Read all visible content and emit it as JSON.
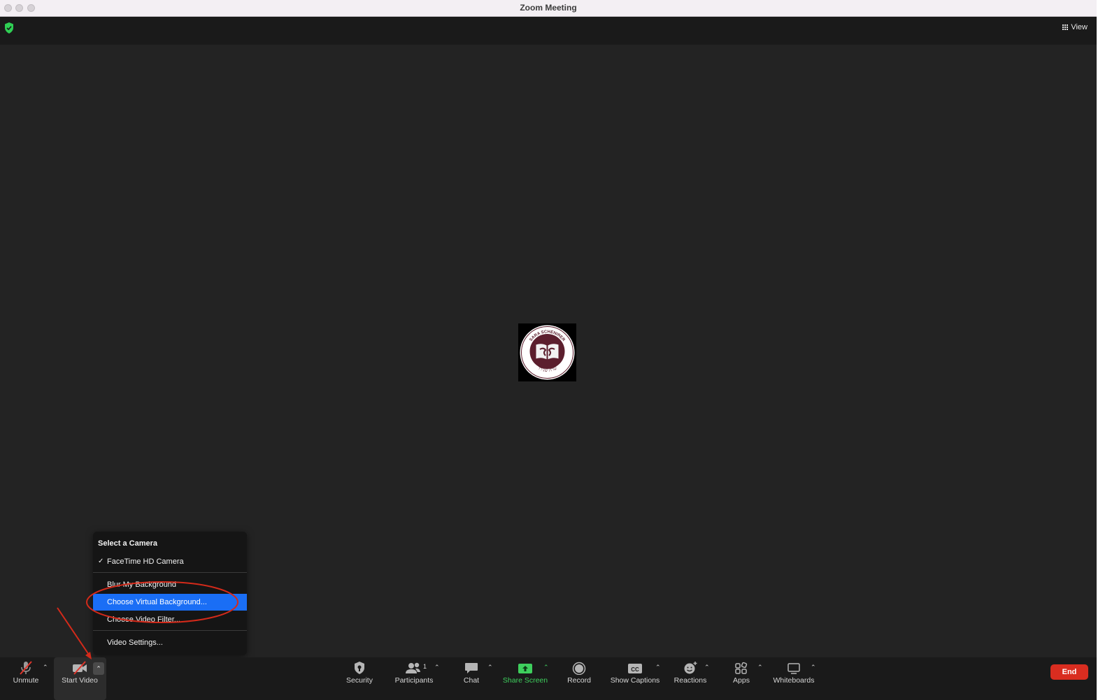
{
  "window": {
    "title": "Zoom Meeting"
  },
  "topbar": {
    "view_label": "View"
  },
  "camera_menu": {
    "header": "Select a Camera",
    "camera_item": "FaceTime HD Camera",
    "blur_item": "Blur My Background",
    "virtual_bg_item": "Choose Virtual Background...",
    "video_filter_item": "Choose Video Filter...",
    "video_settings_item": "Video Settings..."
  },
  "logo": {
    "text_top": "SARA SCHENIRER",
    "text_bottom": "שרה שנירר"
  },
  "toolbar": {
    "unmute": "Unmute",
    "start_video": "Start Video",
    "security": "Security",
    "participants": "Participants",
    "participants_count": "1",
    "chat": "Chat",
    "share_screen": "Share Screen",
    "record": "Record",
    "show_captions": "Show Captions",
    "captions_badge": "CC",
    "reactions": "Reactions",
    "apps": "Apps",
    "whiteboards": "Whiteboards",
    "end": "End"
  },
  "colors": {
    "accent_blue": "#1a6ef5",
    "share_green": "#3ecf5d",
    "end_red": "#d92d20",
    "annotation_red": "#d42a1a"
  }
}
